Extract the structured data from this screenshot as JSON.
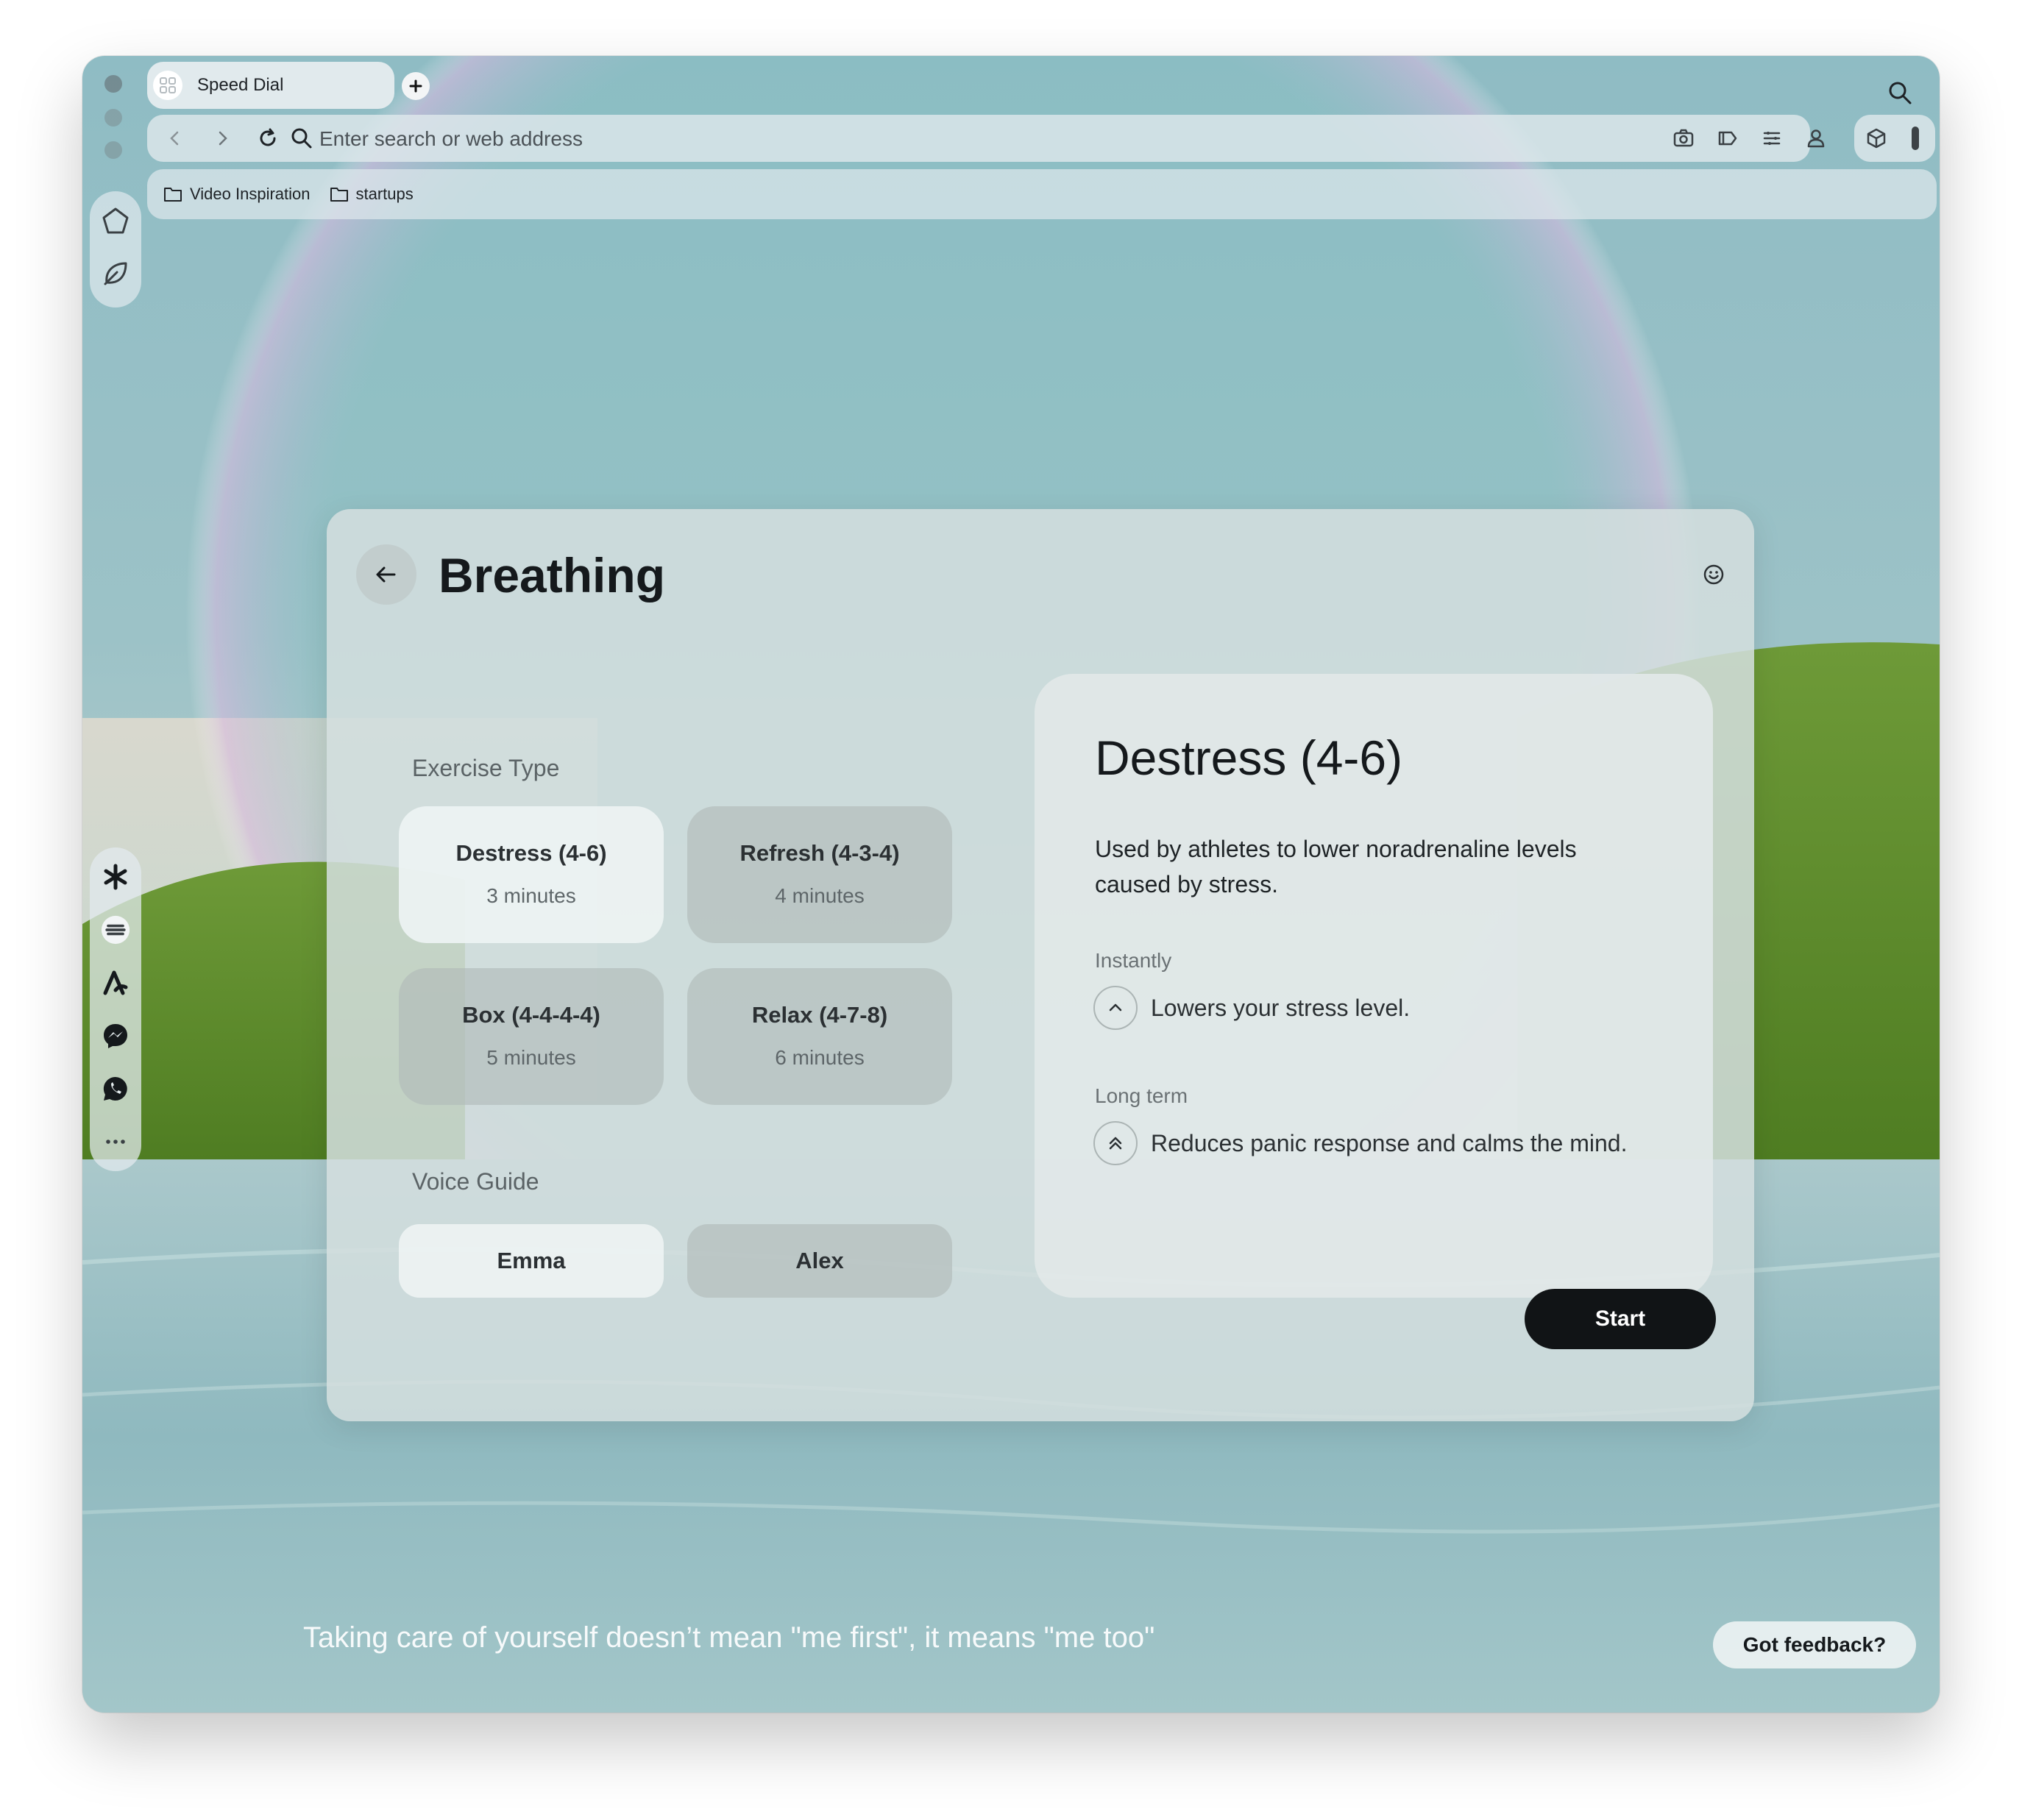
{
  "browser": {
    "tab": {
      "title": "Speed Dial"
    },
    "address_bar": {
      "placeholder": "Enter search or web address"
    },
    "bookmarks": [
      {
        "label": "Video Inspiration",
        "icon": "folder-icon"
      },
      {
        "label": "startups",
        "icon": "folder-icon"
      }
    ],
    "toolbar_icons": [
      "camera-icon",
      "tag-icon",
      "menu-icon",
      "profile-icon",
      "cube-icon"
    ],
    "sidebar_top_icons": [
      "home-icon",
      "leaf-icon"
    ],
    "sidebar_bottom_icons": [
      "perplexity-icon",
      "stripe-icon",
      "arc-icon",
      "messenger-icon",
      "whatsapp-icon",
      "more-icon"
    ]
  },
  "dialog": {
    "title": "Breathing",
    "exercise_label": "Exercise Type",
    "exercises": [
      {
        "name": "Destress (4-6)",
        "duration": "3 minutes",
        "selected": true
      },
      {
        "name": "Refresh (4-3-4)",
        "duration": "4 minutes",
        "selected": false
      },
      {
        "name": "Box (4-4-4-4)",
        "duration": "5 minutes",
        "selected": false
      },
      {
        "name": "Relax (4-7-8)",
        "duration": "6 minutes",
        "selected": false
      }
    ],
    "voice_label": "Voice Guide",
    "voices": [
      {
        "name": "Emma",
        "selected": true
      },
      {
        "name": "Alex",
        "selected": false
      }
    ],
    "detail": {
      "title": "Destress (4-6)",
      "description": "Used by athletes to lower noradrenaline levels caused by stress.",
      "instant_label": "Instantly",
      "instant_benefit": "Lowers your stress level.",
      "long_label": "Long term",
      "long_benefit": "Reduces panic response and calms the mind."
    },
    "start_label": "Start"
  },
  "footer": {
    "quote": "Taking care of yourself doesn’t mean \"me first\", it means \"me too\"",
    "feedback_label": "Got feedback?"
  },
  "colors": {
    "accent_dark": "#111416",
    "card_selected": "#ecf2f2"
  }
}
